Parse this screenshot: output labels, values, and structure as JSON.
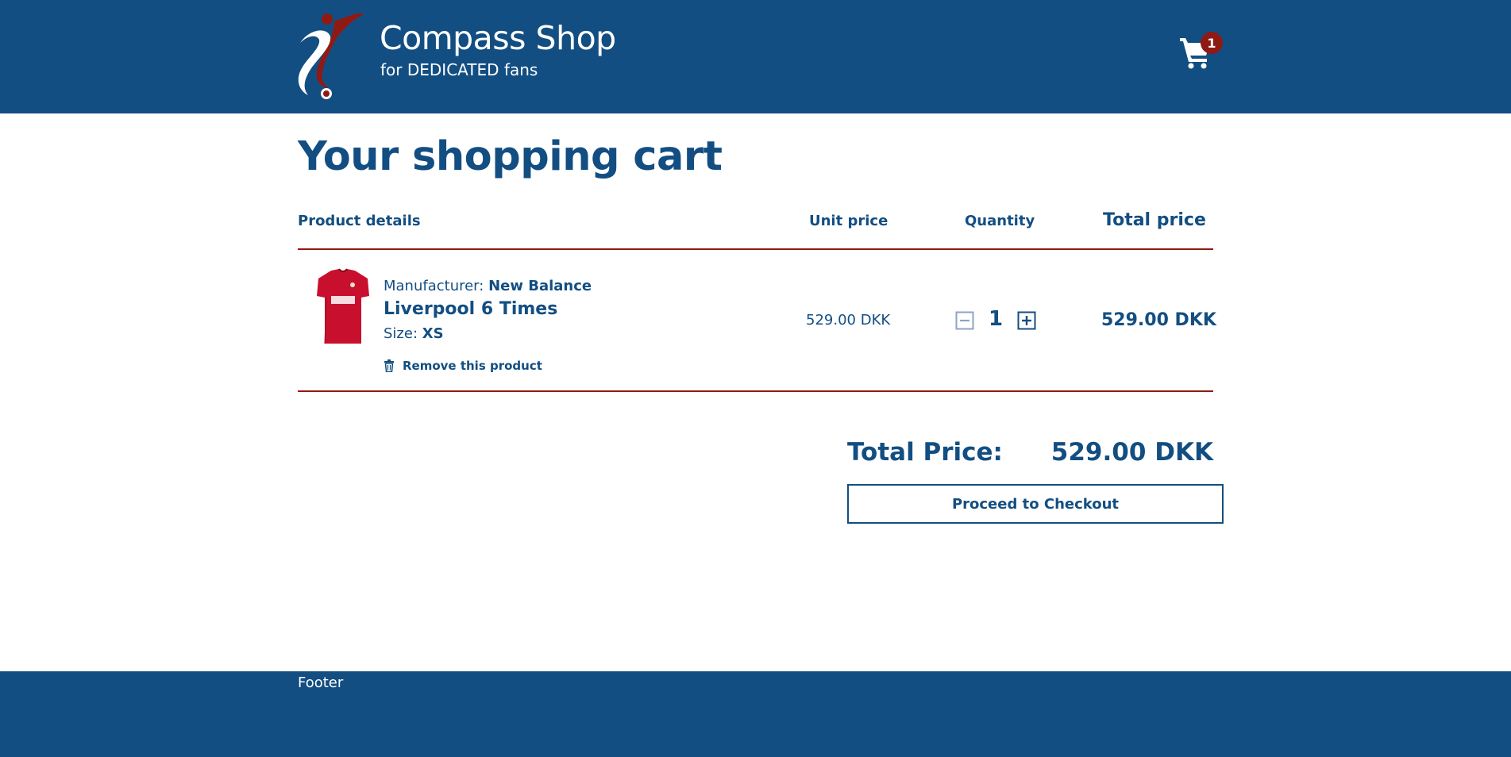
{
  "header": {
    "brand_title": "Compass Shop",
    "brand_subtitle": "for DEDICATED fans",
    "cart_count": "1"
  },
  "page": {
    "title": "Your shopping cart"
  },
  "table": {
    "headers": {
      "product": "Product details",
      "unit_price": "Unit price",
      "quantity": "Quantity",
      "total_price": "Total price"
    },
    "rows": [
      {
        "manufacturer_label": "Manufacturer: ",
        "manufacturer": "New Balance",
        "name": "Liverpool 6 Times",
        "size_label": "Size: ",
        "size": "XS",
        "remove_label": "Remove this product",
        "unit_price": "529.00 DKK",
        "quantity": "1",
        "total_price": "529.00 DKK"
      }
    ]
  },
  "summary": {
    "total_label": "Total Price:",
    "total_value": "529.00 DKK",
    "checkout_label": "Proceed to Checkout"
  },
  "footer": {
    "text": "Footer"
  },
  "colors": {
    "primary": "#134e82",
    "accent": "#8f1a13",
    "background": "#ffffff"
  },
  "icons": {
    "logo": "footballer-logo-icon",
    "cart": "shopping-cart-icon",
    "remove": "trash-icon",
    "decrease": "minus-square-icon",
    "increase": "plus-square-icon"
  }
}
